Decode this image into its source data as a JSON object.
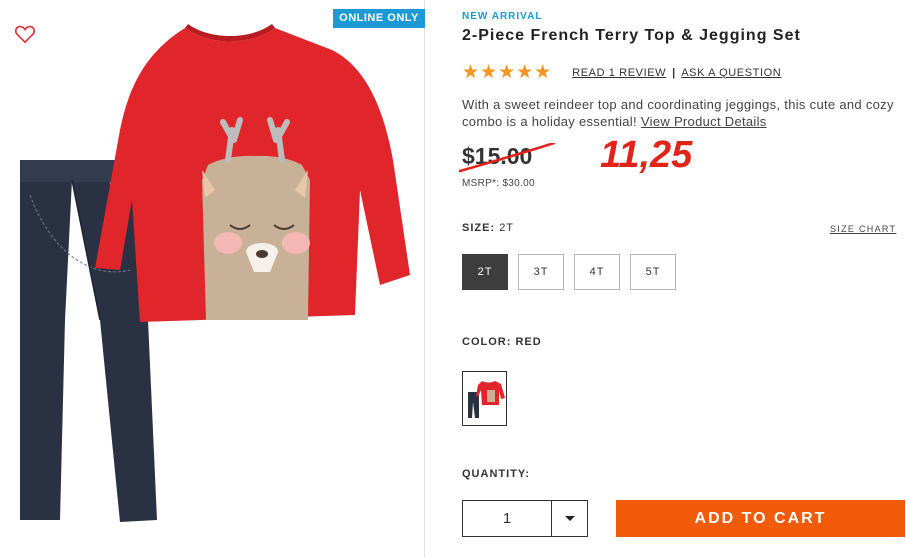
{
  "image_panel": {
    "badge": "ONLINE ONLY",
    "favorite_icon": "heart-outline-icon",
    "product_image": "product-image"
  },
  "product": {
    "tag": "NEW ARRIVAL",
    "title": "2-Piece French Terry Top & Jegging Set",
    "stars": "★★★★★",
    "rating_value": 5,
    "review_link": "READ 1 REVIEW",
    "separator": "|",
    "question_link": "ASK A QUESTION",
    "description": "With a sweet reindeer top and coordinating jeggings, this cute and cozy combo is a holiday essential!",
    "details_link": "View Product Details",
    "price": "$15.00",
    "handwritten_price": "11,25",
    "msrp": "MSRP*: $30.00"
  },
  "size": {
    "label": "SIZE:",
    "selected": "2T",
    "chart_link": "SIZE CHART",
    "options": [
      "2T",
      "3T",
      "4T",
      "5T"
    ]
  },
  "color": {
    "label": "COLOR: RED"
  },
  "quantity": {
    "label": "QUANTITY:",
    "value": "1",
    "arrow_icon": "chevron-down-icon"
  },
  "cart": {
    "button_label": "ADD TO CART"
  },
  "colors": {
    "accent_blue": "#1b9ad6",
    "star_orange": "#f7941d",
    "cart_orange": "#f25b09",
    "annotation_red": "#e2231a",
    "selected_size": "#3d3d3d"
  }
}
